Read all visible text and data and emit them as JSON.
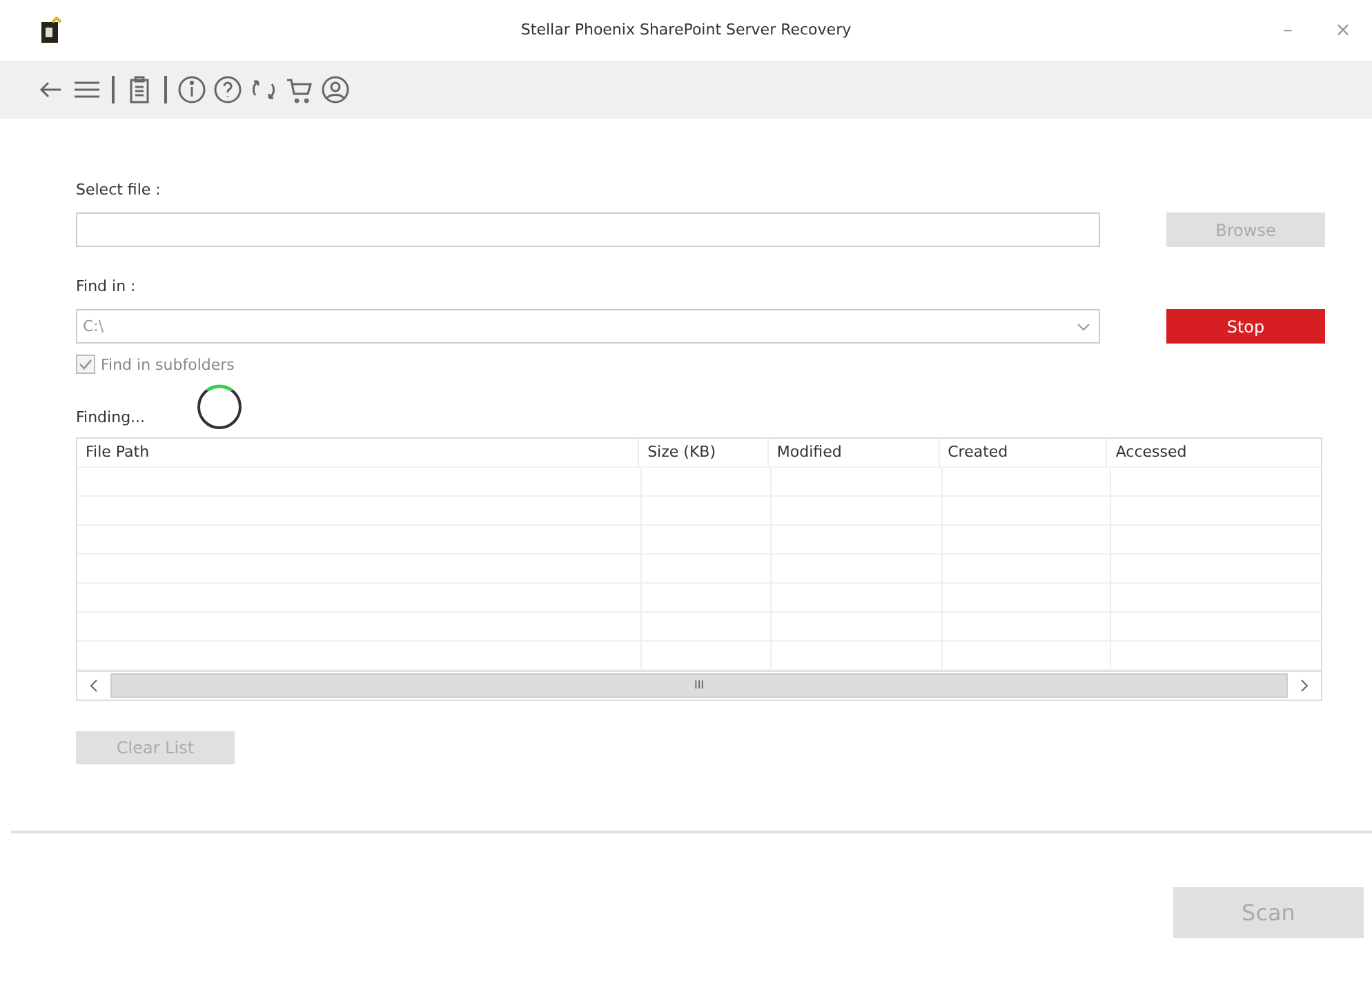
{
  "window": {
    "title": "Stellar Phoenix SharePoint Server Recovery",
    "controls": [
      "–",
      "×"
    ]
  },
  "select_file": {
    "label": "Select file :",
    "browse": {
      "label": "Browse",
      "disabled": true
    }
  },
  "find_in": {
    "label": "Find in :",
    "value": "C:\\",
    "stop": {
      "label": "Stop",
      "disabled": false
    }
  },
  "subfolders": {
    "label": "Find in subfolders",
    "checked": true,
    "disabled": true
  },
  "status": {
    "text": "Finding...",
    "busy": true
  },
  "table": {
    "columns": [
      "File Path",
      "Size (KB)",
      "Modified",
      "Created",
      "Accessed"
    ],
    "scroll_thumb": "III"
  },
  "clear_list": {
    "label": "Clear List",
    "disabled": true
  },
  "scan": {
    "label": "Scan",
    "disabled": true
  }
}
